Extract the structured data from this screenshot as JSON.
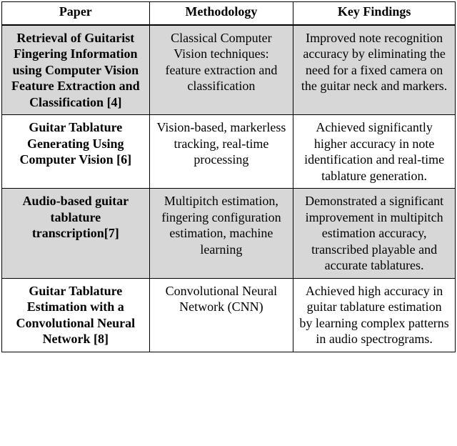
{
  "headers": {
    "paper": "Paper",
    "methodology": "Methodology",
    "findings": "Key Findings"
  },
  "rows": [
    {
      "paper": "Retrieval of Guitarist Fingering Information using Computer Vision Feature Extraction and Classification [4]",
      "methodology": "Classical Computer Vision techniques: feature extraction and classification",
      "findings": "Improved note recognition accuracy by eliminating the need for a fixed camera on the guitar neck and markers."
    },
    {
      "paper": "Guitar Tablature Generating Using Computer Vision [6]",
      "methodology": "Vision-based, markerless tracking, real-time processing",
      "findings": "Achieved significantly higher accuracy in note identification and real-time tablature generation."
    },
    {
      "paper": "Audio-based guitar tablature transcription[7]",
      "methodology": "Multipitch estimation, fingering configuration estimation, machine learning",
      "findings": "Demonstrated a significant improvement in multipitch estimation accuracy, transcribed playable and accurate tablatures."
    },
    {
      "paper": "Guitar Tablature Estimation with a Convolutional Neural Network [8]",
      "methodology": "Convolutional Neural Network (CNN)",
      "findings": "Achieved high accuracy in guitar tablature estimation by learning complex patterns in audio spectrograms."
    }
  ]
}
